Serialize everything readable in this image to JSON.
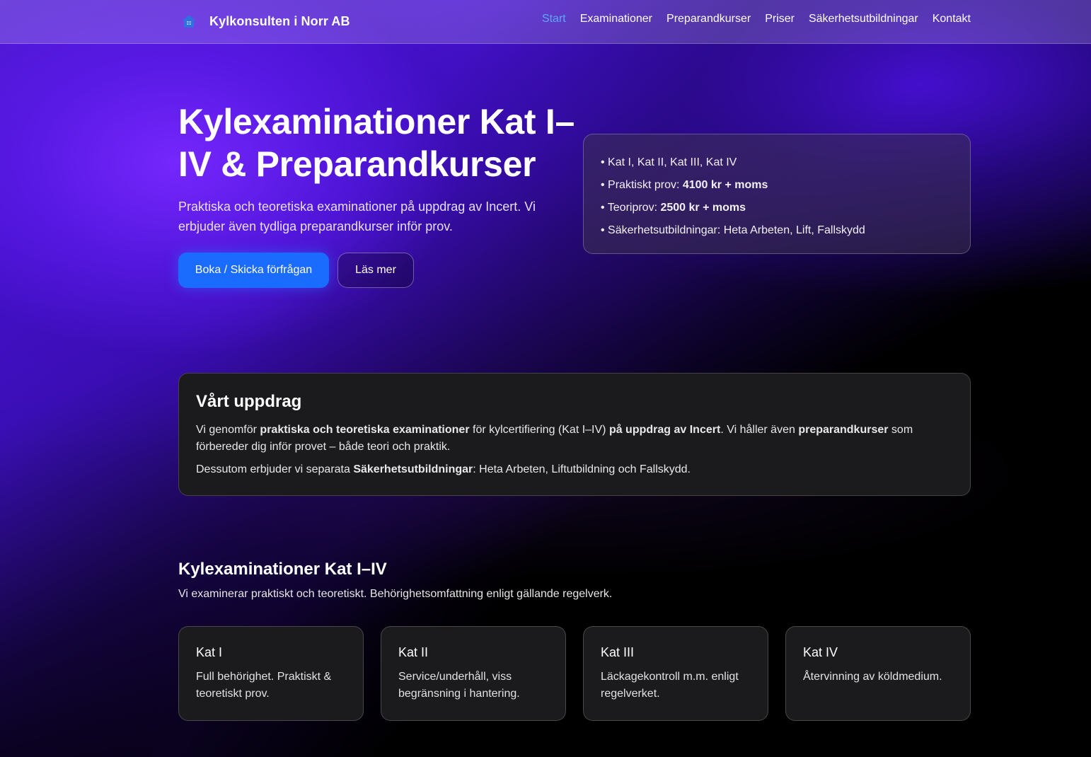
{
  "header": {
    "brand": "Kylkonsulten i Norr AB",
    "nav": [
      "Start",
      "Examinationer",
      "Preparandkurser",
      "Priser",
      "Säkerhetsutbildningar",
      "Kontakt"
    ],
    "active_nav": "Start"
  },
  "hero": {
    "title": "Kylexaminationer Kat I–IV & Preparandkurser",
    "subtitle": "Praktiska och teoretiska examinationer på uppdrag av Incert. Vi erbjuder även tydliga preparandkurser inför prov.",
    "primary_button": "Boka / Skicka förfrågan",
    "secondary_button": "Läs mer",
    "info": {
      "item1": "Kat I, Kat II, Kat III, Kat IV",
      "item2_prefix": "Praktiskt prov: ",
      "item2_value": "4100 kr + moms",
      "item3_prefix": "Teoriprov: ",
      "item3_value": "2500 kr + moms",
      "item4": "Säkerhetsutbildningar: Heta Arbeten, Lift, Fallskydd"
    }
  },
  "mission": {
    "title": "Vårt uppdrag",
    "p1_a": "Vi genomför ",
    "p1_b": "praktiska och teoretiska examinationer",
    "p1_c": " för kylcertifiering (Kat I–IV) ",
    "p1_d": "på uppdrag av Incert",
    "p1_e": ". Vi håller även ",
    "p1_f": "preparandkurser",
    "p1_g": " som förbereder dig inför provet – både teori och praktik.",
    "p2_a": "Dessutom erbjuder vi separata ",
    "p2_b": "Säkerhetsutbildningar",
    "p2_c": ": Heta Arbeten, Liftutbildning och Fallskydd."
  },
  "exams": {
    "title": "Kylexaminationer Kat I–IV",
    "subtitle": "Vi examinerar praktiskt och teoretiskt. Behörighetsomfattning enligt gällande regelverk.",
    "cards": [
      {
        "title": "Kat I",
        "text": "Full behörighet. Praktiskt & teoretiskt prov."
      },
      {
        "title": "Kat II",
        "text": "Service/underhåll, viss begränsning i hantering."
      },
      {
        "title": "Kat III",
        "text": "Läckagekontroll m.m. enligt regelverket."
      },
      {
        "title": "Kat IV",
        "text": "Återvinning av köldmedium."
      }
    ]
  },
  "colors": {
    "accent": "#1a6bff",
    "nav_active": "#5aa7ff",
    "card_bg": "#1b1b1d"
  }
}
